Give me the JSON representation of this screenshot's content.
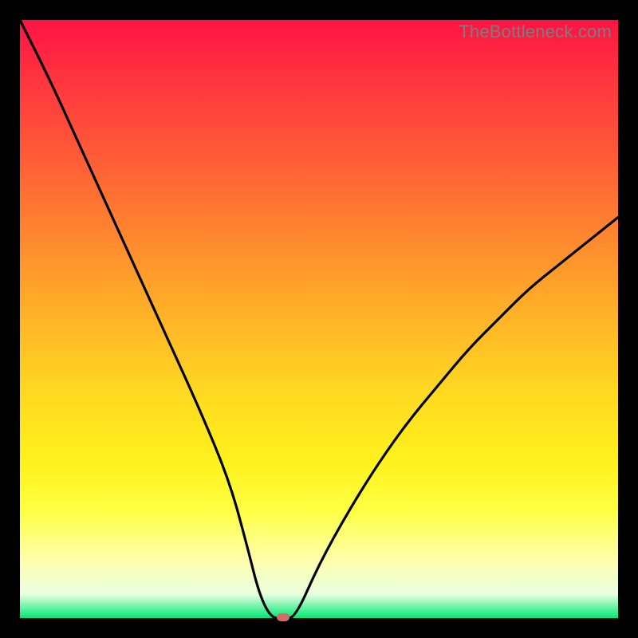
{
  "watermark": "TheBottleneck.com",
  "chart_data": {
    "type": "line",
    "title": "",
    "xlabel": "",
    "ylabel": "",
    "xlim": [
      0,
      100
    ],
    "ylim": [
      0,
      100
    ],
    "x": [
      0,
      5,
      10,
      15,
      20,
      25,
      30,
      35,
      38,
      40,
      42,
      44,
      46,
      50,
      55,
      60,
      65,
      70,
      75,
      80,
      85,
      90,
      95,
      100
    ],
    "values": [
      100,
      90,
      79,
      68,
      57,
      46,
      35,
      23,
      12,
      4,
      0,
      0,
      0,
      9,
      18,
      26,
      33,
      39,
      45,
      50,
      55,
      59,
      63,
      67
    ],
    "marker": {
      "x": 44,
      "y": 0
    },
    "note": "V-shaped bottleneck curve on red-to-green vertical gradient; minimum near x≈43, left branch starts at 100%, right branch rises to ≈67%."
  }
}
